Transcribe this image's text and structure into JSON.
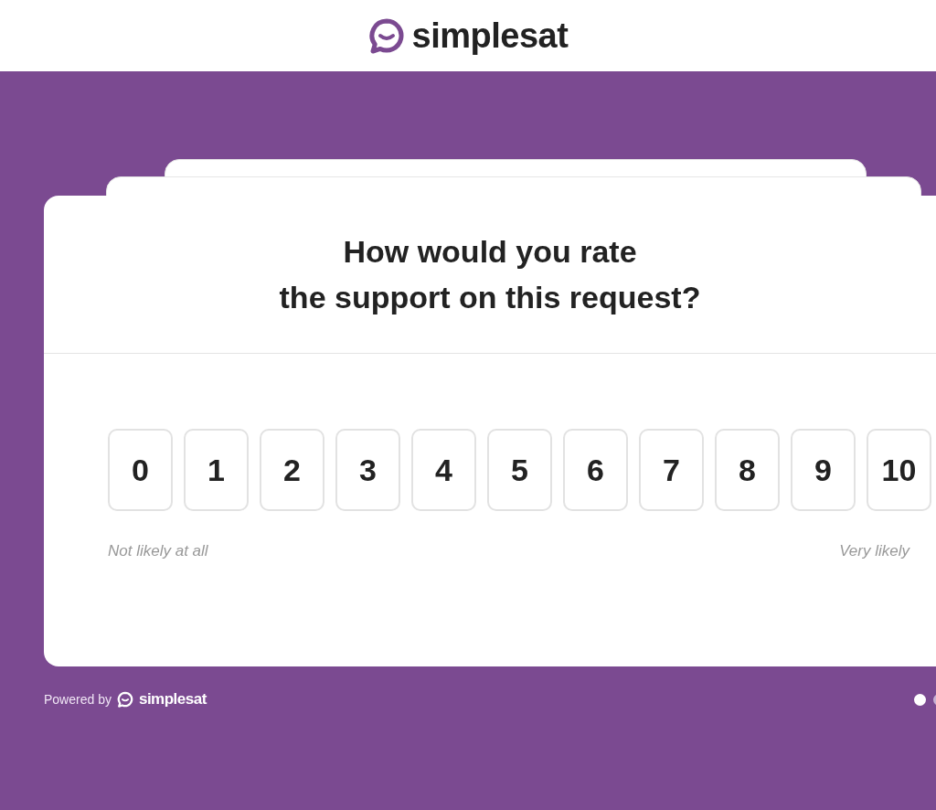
{
  "header": {
    "brand": "simplesat"
  },
  "survey": {
    "question_lines": [
      "How would you rate",
      "the support on this request?"
    ],
    "scale": [
      {
        "label": "0",
        "selected": false
      },
      {
        "label": "1",
        "selected": false
      },
      {
        "label": "2",
        "selected": false
      },
      {
        "label": "3",
        "selected": false
      },
      {
        "label": "4",
        "selected": false
      },
      {
        "label": "5",
        "selected": false
      },
      {
        "label": "6",
        "selected": false
      },
      {
        "label": "7",
        "selected": false
      },
      {
        "label": "8",
        "selected": false
      },
      {
        "label": "9",
        "selected": false
      },
      {
        "label": "10",
        "selected": false
      }
    ],
    "low_label": "Not likely at all",
    "high_label": "Very likely"
  },
  "footer": {
    "powered_by": "Powered by",
    "brand": "simplesat"
  },
  "pages": [
    {
      "selected": true
    },
    {
      "selected": false
    }
  ]
}
